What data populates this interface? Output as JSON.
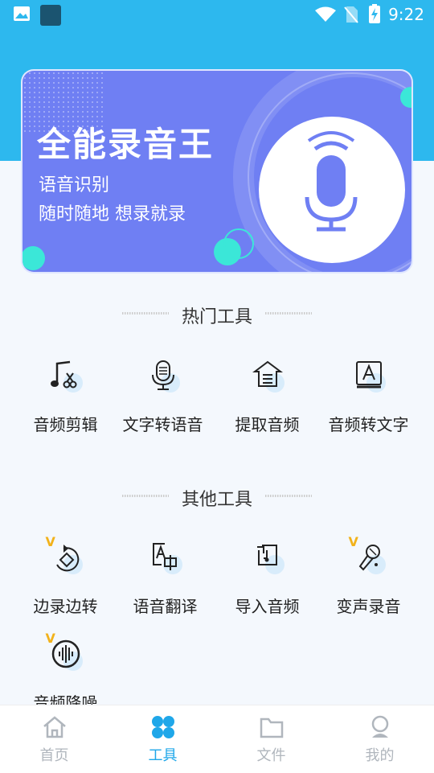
{
  "status_bar": {
    "time": "9:22",
    "icons": [
      "image-icon",
      "app-icon",
      "wifi-icon",
      "no-sim-icon",
      "battery-charging-icon"
    ]
  },
  "banner": {
    "title": "全能录音王",
    "subtitle1": "语音识别",
    "subtitle2": "随时随地 想录就录",
    "icon": "microphone-icon"
  },
  "sections": {
    "hot": {
      "title": "热门工具"
    },
    "other": {
      "title": "其他工具"
    }
  },
  "hot_tools": [
    {
      "label": "音频剪辑",
      "icon": "music-scissors-icon"
    },
    {
      "label": "文字转语音",
      "icon": "microphone-icon"
    },
    {
      "label": "提取音频",
      "icon": "extract-audio-icon"
    },
    {
      "label": "音频转文字",
      "icon": "text-a-icon"
    }
  ],
  "other_tools": [
    {
      "label": "边录边转",
      "icon": "record-convert-icon",
      "vip": true
    },
    {
      "label": "语音翻译",
      "icon": "translate-icon",
      "vip": false
    },
    {
      "label": "导入音频",
      "icon": "import-audio-icon",
      "vip": false
    },
    {
      "label": "变声录音",
      "icon": "voice-change-icon",
      "vip": true
    },
    {
      "label": "音频降噪",
      "icon": "noise-reduction-icon",
      "vip": true
    }
  ],
  "vip_badge": "V",
  "bottom_nav": [
    {
      "label": "首页",
      "icon": "home-icon",
      "active": false
    },
    {
      "label": "工具",
      "icon": "tools-grid-icon",
      "active": true
    },
    {
      "label": "文件",
      "icon": "folder-icon",
      "active": false
    },
    {
      "label": "我的",
      "icon": "profile-icon",
      "active": false
    }
  ],
  "colors": {
    "accent": "#1fa7e9",
    "header": "#2db8ee",
    "banner": "#6f7ff3",
    "vip": "#f2b21b"
  }
}
